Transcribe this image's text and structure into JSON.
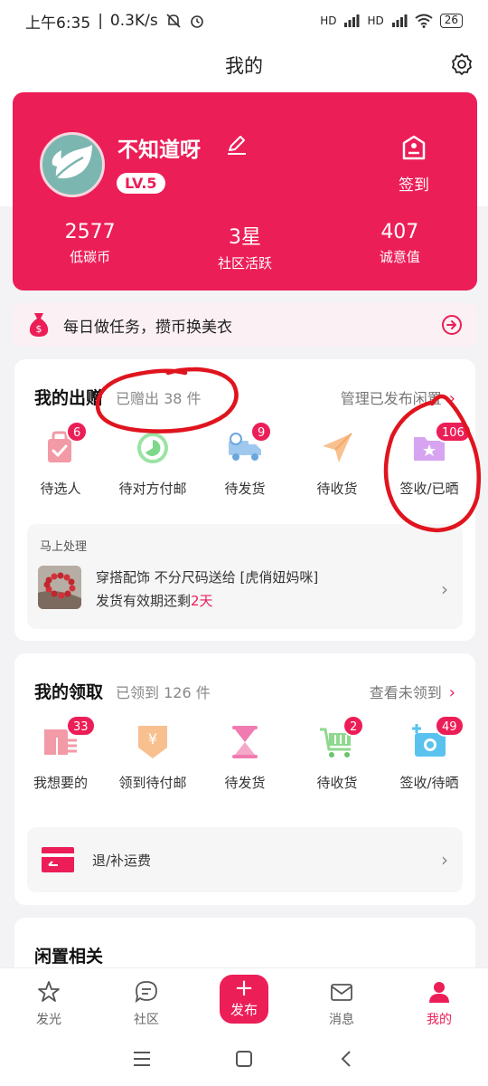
{
  "status_bar": {
    "time": "上午6:35",
    "speed": "0.3K/s",
    "signal_1": "HD",
    "signal_2": "HD",
    "battery": "26"
  },
  "header": {
    "title": "我的",
    "settings_icon": "gear-icon"
  },
  "profile": {
    "username": "不知道呀",
    "level": "LV.5",
    "checkin_label": "签到",
    "stats": [
      {
        "value": "2577",
        "label": "低碳币"
      },
      {
        "value": "3星",
        "label": "社区活跃"
      },
      {
        "value": "407",
        "label": "诚意值"
      }
    ]
  },
  "promo": {
    "text": "每日做任务，攒币换美衣"
  },
  "giving": {
    "title": "我的出赠",
    "count": "已赠出 38 件",
    "link": "管理已发布闲置",
    "items": [
      {
        "label": "待选人",
        "badge": "6",
        "icon": "bag-check-icon"
      },
      {
        "label": "待对方付邮",
        "badge": "",
        "icon": "clock-circle-icon"
      },
      {
        "label": "待发货",
        "badge": "9",
        "icon": "delivery-truck-icon"
      },
      {
        "label": "待收货",
        "badge": "",
        "icon": "paper-plane-icon"
      },
      {
        "label": "签收/已晒",
        "badge": "106",
        "icon": "folder-star-icon"
      }
    ],
    "pending": {
      "title": "马上处理",
      "item_title": "穿搭配饰 不分尺码送给 [虎俏妞妈咪]",
      "deadline_prefix": "发货有效期还剩",
      "deadline_value": "2天"
    }
  },
  "receiving": {
    "title": "我的领取",
    "count": "已领到 126 件",
    "link": "查看未领到",
    "items": [
      {
        "label": "我想要的",
        "badge": "33",
        "icon": "clothes-tag-icon"
      },
      {
        "label": "领到待付邮",
        "badge": "",
        "icon": "yen-envelope-icon"
      },
      {
        "label": "待发货",
        "badge": "",
        "icon": "hourglass-icon"
      },
      {
        "label": "待收货",
        "badge": "2",
        "icon": "cart-icon"
      },
      {
        "label": "签收/待晒",
        "badge": "49",
        "icon": "camera-plus-icon"
      }
    ],
    "refund_label": "退/补运费"
  },
  "idle": {
    "title": "闲置相关"
  },
  "tabs": [
    {
      "label": "发光",
      "icon": "star-icon"
    },
    {
      "label": "社区",
      "icon": "chat-icon"
    },
    {
      "label": "发布",
      "icon": "plus-icon"
    },
    {
      "label": "消息",
      "icon": "mail-icon"
    },
    {
      "label": "我的",
      "icon": "person-icon"
    }
  ],
  "colors": {
    "accent": "#ec1e57",
    "annotation": "#e0141e"
  }
}
